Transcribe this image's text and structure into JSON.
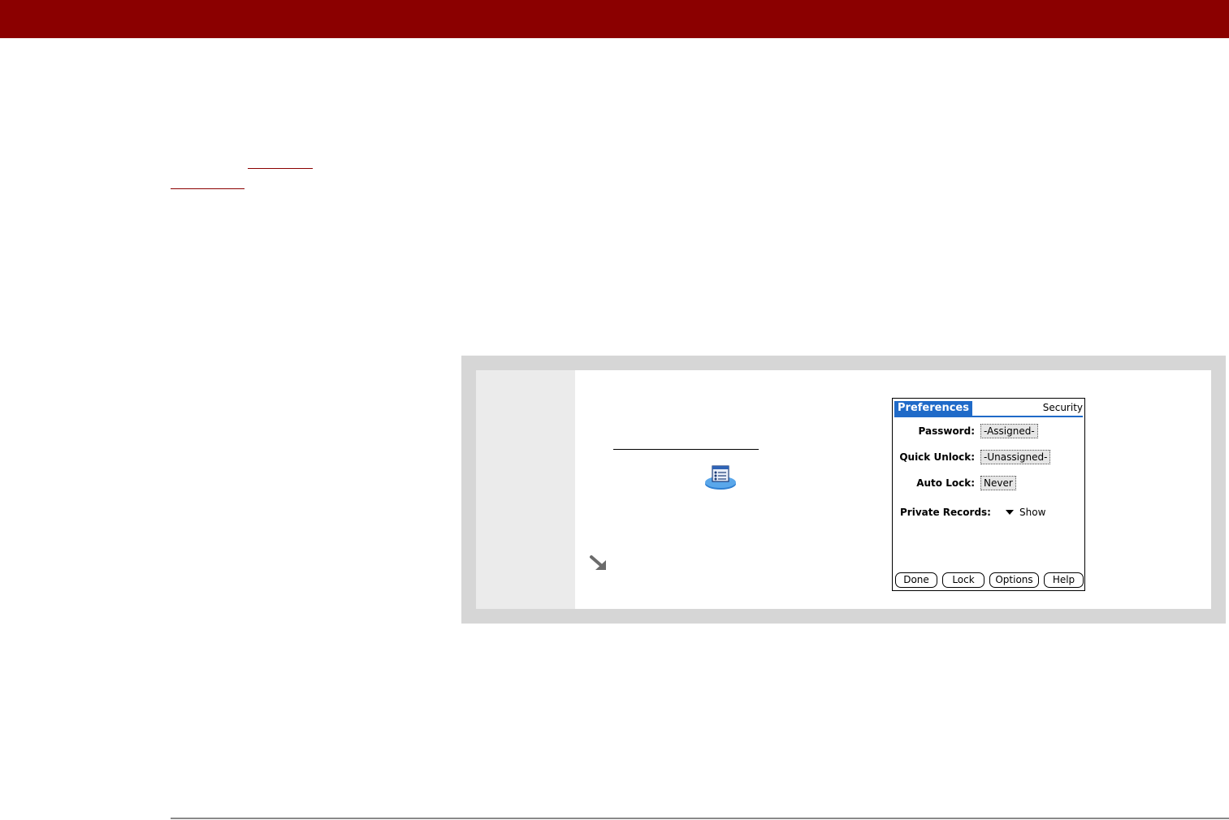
{
  "palm_screen": {
    "title": "Preferences",
    "category": "Security",
    "fields": [
      {
        "label": "Password:",
        "value": "-Assigned-"
      },
      {
        "label": "Quick Unlock:",
        "value": "-Unassigned-"
      },
      {
        "label": "Auto Lock:",
        "value": "Never"
      }
    ],
    "private_records": {
      "label": "Private Records:",
      "value": "Show"
    },
    "buttons": [
      "Done",
      "Lock",
      "Options",
      "Help"
    ]
  },
  "colors": {
    "banner": "#8b0000",
    "palm_title_bar": "#1f6ac8",
    "step_frame": "#d6d6d6",
    "step_number_column": "#ebebeb"
  },
  "icons": {
    "app_icon": "preferences-app-icon",
    "tip_arrow": "tip-arrow-icon",
    "menu_arrow": "triangle-down-icon"
  }
}
